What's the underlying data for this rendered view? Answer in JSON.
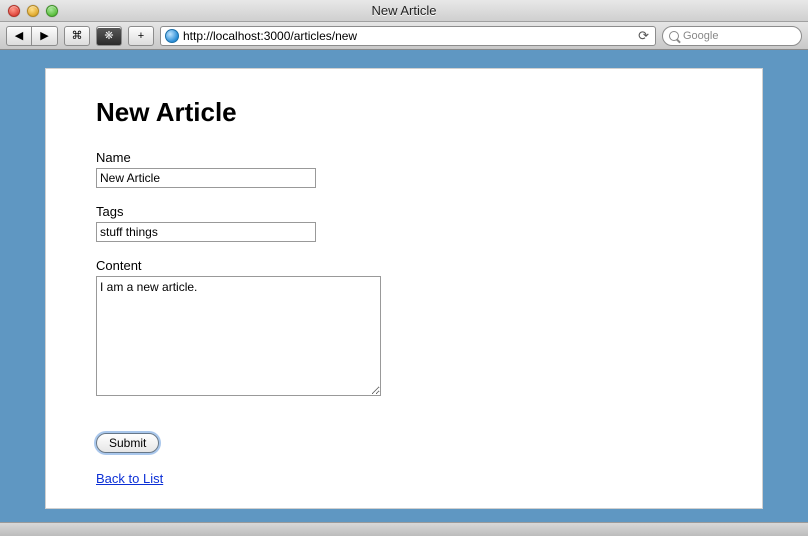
{
  "window": {
    "title": "New Article"
  },
  "toolbar": {
    "back_glyph": "◀",
    "forward_glyph": "▶",
    "reader_glyph": "⌘",
    "evernote_glyph": "❋",
    "add_glyph": "+",
    "reload_glyph": "⟳",
    "url": "http://localhost:3000/articles/new",
    "search_placeholder": "Google"
  },
  "page": {
    "heading": "New Article",
    "fields": {
      "name": {
        "label": "Name",
        "value": "New Article"
      },
      "tags": {
        "label": "Tags",
        "value": "stuff things"
      },
      "content": {
        "label": "Content",
        "value": "I am a new article."
      }
    },
    "submit_label": "Submit",
    "back_link_label": "Back to List"
  }
}
